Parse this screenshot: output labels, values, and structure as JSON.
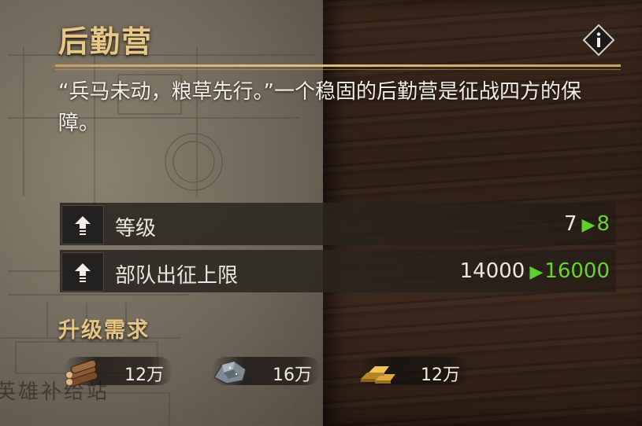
{
  "panel": {
    "title": "后勤营",
    "description": "“兵马未动，粮草先行。”一个稳固的后勤营是征战四方的保障。"
  },
  "stats": [
    {
      "label": "等级",
      "current": "7",
      "next": "8"
    },
    {
      "label": "部队出征上限",
      "current": "14000",
      "next": "16000"
    }
  ],
  "requirements": {
    "title": "升级需求",
    "items": [
      {
        "icon": "wood-log-icon",
        "amount": "12万"
      },
      {
        "icon": "ore-stone-icon",
        "amount": "16万"
      },
      {
        "icon": "gold-bar-icon",
        "amount": "12万"
      }
    ]
  },
  "background": {
    "sign_text": "英雄补给站"
  },
  "arrow_glyph": "▶",
  "colors": {
    "title": "#e6c88a",
    "upgrade_value": "#66d433",
    "text": "#f2efe6"
  }
}
